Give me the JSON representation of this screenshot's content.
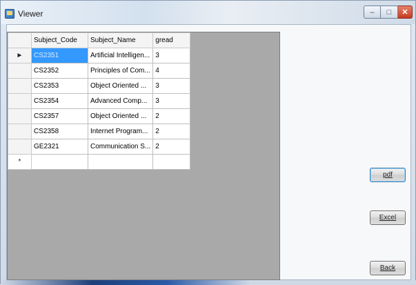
{
  "window": {
    "title": "Viewer",
    "controls": {
      "minimize": "–",
      "maximize": "□",
      "close": "✕"
    }
  },
  "grid": {
    "columns": [
      "Subject_Code",
      "Subject_Name",
      "gread"
    ],
    "rows": [
      {
        "indicator": "►",
        "code": "CS2351",
        "name": "Artificial Intelligen...",
        "gread": "3"
      },
      {
        "indicator": "",
        "code": "CS2352",
        "name": "Principles of Com...",
        "gread": "4"
      },
      {
        "indicator": "",
        "code": "CS2353",
        "name": "Object Oriented ...",
        "gread": "3"
      },
      {
        "indicator": "",
        "code": "CS2354",
        "name": "Advanced Comp...",
        "gread": "3"
      },
      {
        "indicator": "",
        "code": "CS2357",
        "name": "Object Oriented ...",
        "gread": "2"
      },
      {
        "indicator": "",
        "code": "CS2358",
        "name": "Internet Program...",
        "gread": "2"
      },
      {
        "indicator": "",
        "code": "GE2321",
        "name": "Communication S...",
        "gread": "2"
      }
    ],
    "new_row_indicator": "*"
  },
  "buttons": {
    "pdf": "pdf",
    "excel": "Excel",
    "back": "Back"
  },
  "colors": {
    "selection": "#3399ff",
    "grid_background": "#a9a9a9"
  }
}
